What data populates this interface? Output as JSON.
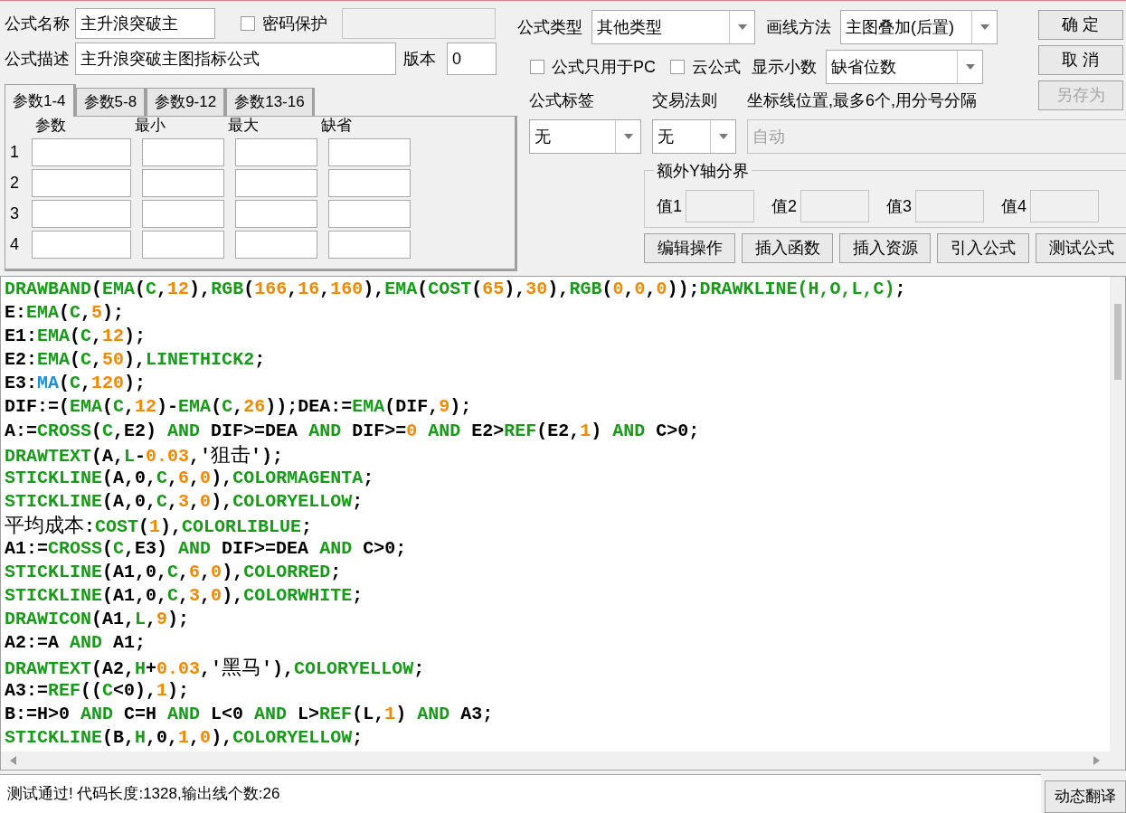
{
  "formula_name": {
    "label": "公式名称",
    "value": "主升浪突破主"
  },
  "password": {
    "label": "密码保护",
    "checked": false
  },
  "description": {
    "label": "公式描述",
    "value": "主升浪突破主图指标公式"
  },
  "version": {
    "label": "版本",
    "value": "0"
  },
  "param_tabs": [
    {
      "label": "参数1-4",
      "selected": true
    },
    {
      "label": "参数5-8",
      "selected": false
    },
    {
      "label": "参数9-12",
      "selected": false
    },
    {
      "label": "参数13-16",
      "selected": false
    }
  ],
  "param_columns": [
    "参数",
    "最小",
    "最大",
    "缺省"
  ],
  "param_rows": [
    "1",
    "2",
    "3",
    "4"
  ],
  "formula_type": {
    "label": "公式类型",
    "value": "其他类型"
  },
  "draw_method": {
    "label": "画线方法",
    "value": "主图叠加(后置)"
  },
  "pc_only": {
    "label": "公式只用于PC",
    "checked": false
  },
  "cloud": {
    "label": "云公式",
    "checked": false
  },
  "decimals": {
    "label": "显示小数",
    "value": "缺省位数"
  },
  "side_buttons": [
    {
      "label": "确 定",
      "disabled": false
    },
    {
      "label": "取 消",
      "disabled": false
    },
    {
      "label": "另存为",
      "disabled": true
    }
  ],
  "tag": {
    "label": "公式标签",
    "value": "无"
  },
  "trade_rule": {
    "label": "交易法则",
    "value": "无"
  },
  "axis_lines": {
    "label": "坐标线位置,最多6个,用分号分隔",
    "value": "自动",
    "disabled": true
  },
  "y_axis": {
    "title": "额外Y轴分界",
    "fields": [
      "值1",
      "值2",
      "值3",
      "值4"
    ]
  },
  "tool_buttons": [
    "编辑操作",
    "插入函数",
    "插入资源",
    "引入公式",
    "测试公式"
  ],
  "code_lines": [
    [
      {
        "kind": "fn",
        "text": "DRAWBAND"
      },
      {
        "kind": "plain",
        "text": "("
      },
      {
        "kind": "fn",
        "text": "EMA"
      },
      {
        "kind": "plain",
        "text": "("
      },
      {
        "kind": "fn",
        "text": "C"
      },
      {
        "kind": "plain",
        "text": ","
      },
      {
        "kind": "num",
        "text": "12"
      },
      {
        "kind": "plain",
        "text": "),"
      },
      {
        "kind": "fn",
        "text": "RGB"
      },
      {
        "kind": "plain",
        "text": "("
      },
      {
        "kind": "num",
        "text": "166"
      },
      {
        "kind": "plain",
        "text": ","
      },
      {
        "kind": "num",
        "text": "16"
      },
      {
        "kind": "plain",
        "text": ","
      },
      {
        "kind": "num",
        "text": "160"
      },
      {
        "kind": "plain",
        "text": "),"
      },
      {
        "kind": "fn",
        "text": "EMA"
      },
      {
        "kind": "plain",
        "text": "("
      },
      {
        "kind": "fn",
        "text": "COST"
      },
      {
        "kind": "plain",
        "text": "("
      },
      {
        "kind": "num",
        "text": "65"
      },
      {
        "kind": "plain",
        "text": "),"
      },
      {
        "kind": "num",
        "text": "30"
      },
      {
        "kind": "plain",
        "text": "),"
      },
      {
        "kind": "fn",
        "text": "RGB"
      },
      {
        "kind": "plain",
        "text": "("
      },
      {
        "kind": "num",
        "text": "0"
      },
      {
        "kind": "plain",
        "text": ","
      },
      {
        "kind": "num",
        "text": "0"
      },
      {
        "kind": "plain",
        "text": ","
      },
      {
        "kind": "num",
        "text": "0"
      },
      {
        "kind": "plain",
        "text": "));"
      },
      {
        "kind": "fn",
        "text": "DRAWKLINE(H,O,L,C)"
      },
      {
        "kind": "plain",
        "text": ";"
      }
    ],
    [
      {
        "kind": "plain",
        "text": "E:"
      },
      {
        "kind": "fn",
        "text": "EMA"
      },
      {
        "kind": "plain",
        "text": "("
      },
      {
        "kind": "fn",
        "text": "C"
      },
      {
        "kind": "plain",
        "text": ","
      },
      {
        "kind": "num",
        "text": "5"
      },
      {
        "kind": "plain",
        "text": ");"
      }
    ],
    [
      {
        "kind": "plain",
        "text": "E1:"
      },
      {
        "kind": "fn",
        "text": "EMA"
      },
      {
        "kind": "plain",
        "text": "("
      },
      {
        "kind": "fn",
        "text": "C"
      },
      {
        "kind": "plain",
        "text": ","
      },
      {
        "kind": "num",
        "text": "12"
      },
      {
        "kind": "plain",
        "text": ");"
      }
    ],
    [
      {
        "kind": "plain",
        "text": "E2:"
      },
      {
        "kind": "fn",
        "text": "EMA"
      },
      {
        "kind": "plain",
        "text": "("
      },
      {
        "kind": "fn",
        "text": "C"
      },
      {
        "kind": "plain",
        "text": ","
      },
      {
        "kind": "num",
        "text": "50"
      },
      {
        "kind": "plain",
        "text": "),"
      },
      {
        "kind": "fn",
        "text": "LINETHICK2"
      },
      {
        "kind": "plain",
        "text": ";"
      }
    ],
    [
      {
        "kind": "plain",
        "text": "E3:"
      },
      {
        "kind": "builtin",
        "text": "MA"
      },
      {
        "kind": "plain",
        "text": "("
      },
      {
        "kind": "fn",
        "text": "C"
      },
      {
        "kind": "plain",
        "text": ","
      },
      {
        "kind": "num",
        "text": "120"
      },
      {
        "kind": "plain",
        "text": ");"
      }
    ],
    [
      {
        "kind": "plain",
        "text": "DIF:=("
      },
      {
        "kind": "fn",
        "text": "EMA"
      },
      {
        "kind": "plain",
        "text": "("
      },
      {
        "kind": "fn",
        "text": "C"
      },
      {
        "kind": "plain",
        "text": ","
      },
      {
        "kind": "num",
        "text": "12"
      },
      {
        "kind": "plain",
        "text": ")-"
      },
      {
        "kind": "fn",
        "text": "EMA"
      },
      {
        "kind": "plain",
        "text": "("
      },
      {
        "kind": "fn",
        "text": "C"
      },
      {
        "kind": "plain",
        "text": ","
      },
      {
        "kind": "num",
        "text": "26"
      },
      {
        "kind": "plain",
        "text": "));DEA:="
      },
      {
        "kind": "fn",
        "text": "EMA"
      },
      {
        "kind": "plain",
        "text": "(DIF,"
      },
      {
        "kind": "num",
        "text": "9"
      },
      {
        "kind": "plain",
        "text": ");"
      }
    ],
    [
      {
        "kind": "plain",
        "text": "A:="
      },
      {
        "kind": "fn",
        "text": "CROSS"
      },
      {
        "kind": "plain",
        "text": "("
      },
      {
        "kind": "fn",
        "text": "C"
      },
      {
        "kind": "plain",
        "text": ",E2) "
      },
      {
        "kind": "fn",
        "text": "AND"
      },
      {
        "kind": "plain",
        "text": " DIF>=DEA "
      },
      {
        "kind": "fn",
        "text": "AND"
      },
      {
        "kind": "plain",
        "text": " DIF>="
      },
      {
        "kind": "num",
        "text": "0"
      },
      {
        "kind": "fn",
        "text": " AND"
      },
      {
        "kind": "plain",
        "text": " E2>"
      },
      {
        "kind": "fn",
        "text": "REF"
      },
      {
        "kind": "plain",
        "text": "(E2,"
      },
      {
        "kind": "num",
        "text": "1"
      },
      {
        "kind": "plain",
        "text": ") "
      },
      {
        "kind": "fn",
        "text": "AND"
      },
      {
        "kind": "plain",
        "text": " C>0;"
      }
    ],
    [
      {
        "kind": "fn",
        "text": "DRAWTEXT"
      },
      {
        "kind": "plain",
        "text": "(A,"
      },
      {
        "kind": "fn",
        "text": "L"
      },
      {
        "kind": "plain",
        "text": "-"
      },
      {
        "kind": "num",
        "text": "0.03"
      },
      {
        "kind": "plain",
        "text": ",'"
      },
      {
        "kind": "cn",
        "text": "狙击"
      },
      {
        "kind": "plain",
        "text": "');"
      }
    ],
    [
      {
        "kind": "fn",
        "text": "STICKLINE"
      },
      {
        "kind": "plain",
        "text": "(A,0,"
      },
      {
        "kind": "fn",
        "text": "C"
      },
      {
        "kind": "plain",
        "text": ","
      },
      {
        "kind": "num",
        "text": "6"
      },
      {
        "kind": "plain",
        "text": ","
      },
      {
        "kind": "num",
        "text": "0"
      },
      {
        "kind": "plain",
        "text": "),"
      },
      {
        "kind": "fn",
        "text": "COLORMAGENTA"
      },
      {
        "kind": "plain",
        "text": ";"
      }
    ],
    [
      {
        "kind": "fn",
        "text": "STICKLINE"
      },
      {
        "kind": "plain",
        "text": "(A,0,"
      },
      {
        "kind": "fn",
        "text": "C"
      },
      {
        "kind": "plain",
        "text": ","
      },
      {
        "kind": "num",
        "text": "3"
      },
      {
        "kind": "plain",
        "text": ","
      },
      {
        "kind": "num",
        "text": "0"
      },
      {
        "kind": "plain",
        "text": "),"
      },
      {
        "kind": "fn",
        "text": "COLORYELLOW"
      },
      {
        "kind": "plain",
        "text": ";"
      }
    ],
    [
      {
        "kind": "cn",
        "text": "平均成本"
      },
      {
        "kind": "plain",
        "text": ":"
      },
      {
        "kind": "fn",
        "text": "COST"
      },
      {
        "kind": "plain",
        "text": "("
      },
      {
        "kind": "num",
        "text": "1"
      },
      {
        "kind": "plain",
        "text": "),"
      },
      {
        "kind": "fn",
        "text": "COLORLIBLUE"
      },
      {
        "kind": "plain",
        "text": ";"
      }
    ],
    [
      {
        "kind": "plain",
        "text": "A1:="
      },
      {
        "kind": "fn",
        "text": "CROSS"
      },
      {
        "kind": "plain",
        "text": "("
      },
      {
        "kind": "fn",
        "text": "C"
      },
      {
        "kind": "plain",
        "text": ",E3) "
      },
      {
        "kind": "fn",
        "text": "AND"
      },
      {
        "kind": "plain",
        "text": " DIF>=DEA "
      },
      {
        "kind": "fn",
        "text": "AND"
      },
      {
        "kind": "plain",
        "text": " C>0;"
      }
    ],
    [
      {
        "kind": "fn",
        "text": "STICKLINE"
      },
      {
        "kind": "plain",
        "text": "(A1,0,"
      },
      {
        "kind": "fn",
        "text": "C"
      },
      {
        "kind": "plain",
        "text": ","
      },
      {
        "kind": "num",
        "text": "6"
      },
      {
        "kind": "plain",
        "text": ","
      },
      {
        "kind": "num",
        "text": "0"
      },
      {
        "kind": "plain",
        "text": "),"
      },
      {
        "kind": "fn",
        "text": "COLORRED"
      },
      {
        "kind": "plain",
        "text": ";"
      }
    ],
    [
      {
        "kind": "fn",
        "text": "STICKLINE"
      },
      {
        "kind": "plain",
        "text": "(A1,0,"
      },
      {
        "kind": "fn",
        "text": "C"
      },
      {
        "kind": "plain",
        "text": ","
      },
      {
        "kind": "num",
        "text": "3"
      },
      {
        "kind": "plain",
        "text": ","
      },
      {
        "kind": "num",
        "text": "0"
      },
      {
        "kind": "plain",
        "text": "),"
      },
      {
        "kind": "fn",
        "text": "COLORWHITE"
      },
      {
        "kind": "plain",
        "text": ";"
      }
    ],
    [
      {
        "kind": "fn",
        "text": "DRAWICON"
      },
      {
        "kind": "plain",
        "text": "(A1,"
      },
      {
        "kind": "fn",
        "text": "L"
      },
      {
        "kind": "plain",
        "text": ","
      },
      {
        "kind": "num",
        "text": "9"
      },
      {
        "kind": "plain",
        "text": ");"
      }
    ],
    [
      {
        "kind": "plain",
        "text": "A2:=A "
      },
      {
        "kind": "fn",
        "text": "AND"
      },
      {
        "kind": "plain",
        "text": " A1;"
      }
    ],
    [
      {
        "kind": "fn",
        "text": "DRAWTEXT"
      },
      {
        "kind": "plain",
        "text": "(A2,"
      },
      {
        "kind": "fn",
        "text": "H"
      },
      {
        "kind": "plain",
        "text": "+"
      },
      {
        "kind": "num",
        "text": "0.03"
      },
      {
        "kind": "plain",
        "text": ",'"
      },
      {
        "kind": "cn",
        "text": "黑马"
      },
      {
        "kind": "plain",
        "text": "'),"
      },
      {
        "kind": "fn",
        "text": "COLORYELLOW"
      },
      {
        "kind": "plain",
        "text": ";"
      }
    ],
    [
      {
        "kind": "plain",
        "text": "A3:="
      },
      {
        "kind": "fn",
        "text": "REF"
      },
      {
        "kind": "plain",
        "text": "(("
      },
      {
        "kind": "fn",
        "text": "C"
      },
      {
        "kind": "plain",
        "text": "<0),"
      },
      {
        "kind": "num",
        "text": "1"
      },
      {
        "kind": "plain",
        "text": ");"
      }
    ],
    [
      {
        "kind": "plain",
        "text": "B:=H>0 "
      },
      {
        "kind": "fn",
        "text": "AND"
      },
      {
        "kind": "plain",
        "text": " C=H "
      },
      {
        "kind": "fn",
        "text": "AND"
      },
      {
        "kind": "plain",
        "text": " L<0 "
      },
      {
        "kind": "fn",
        "text": "AND"
      },
      {
        "kind": "plain",
        "text": " L>"
      },
      {
        "kind": "fn",
        "text": "REF"
      },
      {
        "kind": "plain",
        "text": "(L,"
      },
      {
        "kind": "num",
        "text": "1"
      },
      {
        "kind": "plain",
        "text": ") "
      },
      {
        "kind": "fn",
        "text": "AND"
      },
      {
        "kind": "plain",
        "text": " A3;"
      }
    ],
    [
      {
        "kind": "fn",
        "text": "STICKLINE"
      },
      {
        "kind": "plain",
        "text": "(B,"
      },
      {
        "kind": "fn",
        "text": "H"
      },
      {
        "kind": "plain",
        "text": ",0,"
      },
      {
        "kind": "num",
        "text": "1"
      },
      {
        "kind": "plain",
        "text": ","
      },
      {
        "kind": "num",
        "text": "0"
      },
      {
        "kind": "plain",
        "text": "),"
      },
      {
        "kind": "fn",
        "text": "COLORYELLOW"
      },
      {
        "kind": "plain",
        "text": ";"
      }
    ]
  ],
  "status": {
    "message": "测试通过! 代码长度:1328,输出线个数:26",
    "button": "动态翻译"
  }
}
